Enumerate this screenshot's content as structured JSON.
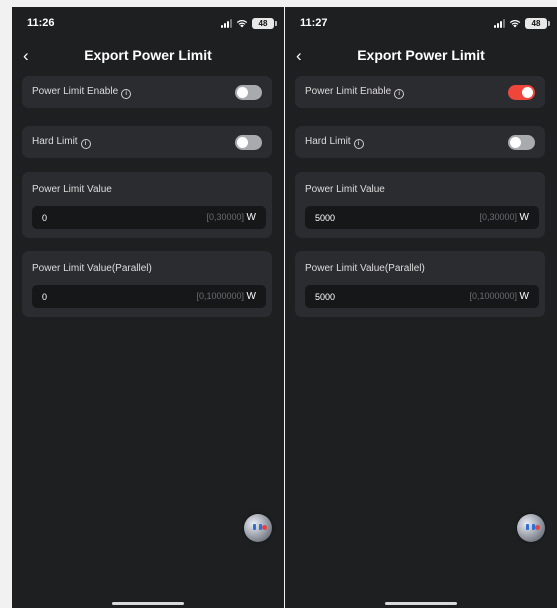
{
  "screens": [
    {
      "status": {
        "time": "11:26",
        "battery": "48"
      },
      "nav": {
        "back": "‹",
        "title": "Export Power Limit"
      },
      "power_limit_enable": {
        "label": "Power Limit Enable",
        "info": "i",
        "state": "off"
      },
      "hard_limit": {
        "label": "Hard Limit",
        "info": "i",
        "state": "off"
      },
      "power_limit_value": {
        "label": "Power Limit Value",
        "value": "0",
        "range": "[0,30000]",
        "unit": "W"
      },
      "power_limit_value_parallel": {
        "label": "Power Limit Value(Parallel)",
        "value": "0",
        "range": "[0,1000000]",
        "unit": "W"
      }
    },
    {
      "status": {
        "time": "11:27",
        "battery": "48"
      },
      "nav": {
        "back": "‹",
        "title": "Export Power Limit"
      },
      "power_limit_enable": {
        "label": "Power Limit Enable",
        "info": "i",
        "state": "on"
      },
      "hard_limit": {
        "label": "Hard Limit",
        "info": "i",
        "state": "off"
      },
      "power_limit_value": {
        "label": "Power Limit Value",
        "value": "5000",
        "range": "[0,30000]",
        "unit": "W"
      },
      "power_limit_value_parallel": {
        "label": "Power Limit Value(Parallel)",
        "value": "5000",
        "range": "[0,1000000]",
        "unit": "W"
      }
    }
  ],
  "colors": {
    "toggle_on": "#f0453a",
    "toggle_off": "#a9aaae",
    "background": "#1e1f21",
    "card": "#2b2c2f"
  },
  "icons": [
    "back-chevron-icon",
    "info-icon",
    "signal-icon",
    "wifi-icon",
    "battery-icon",
    "assistant-bubble-icon"
  ]
}
